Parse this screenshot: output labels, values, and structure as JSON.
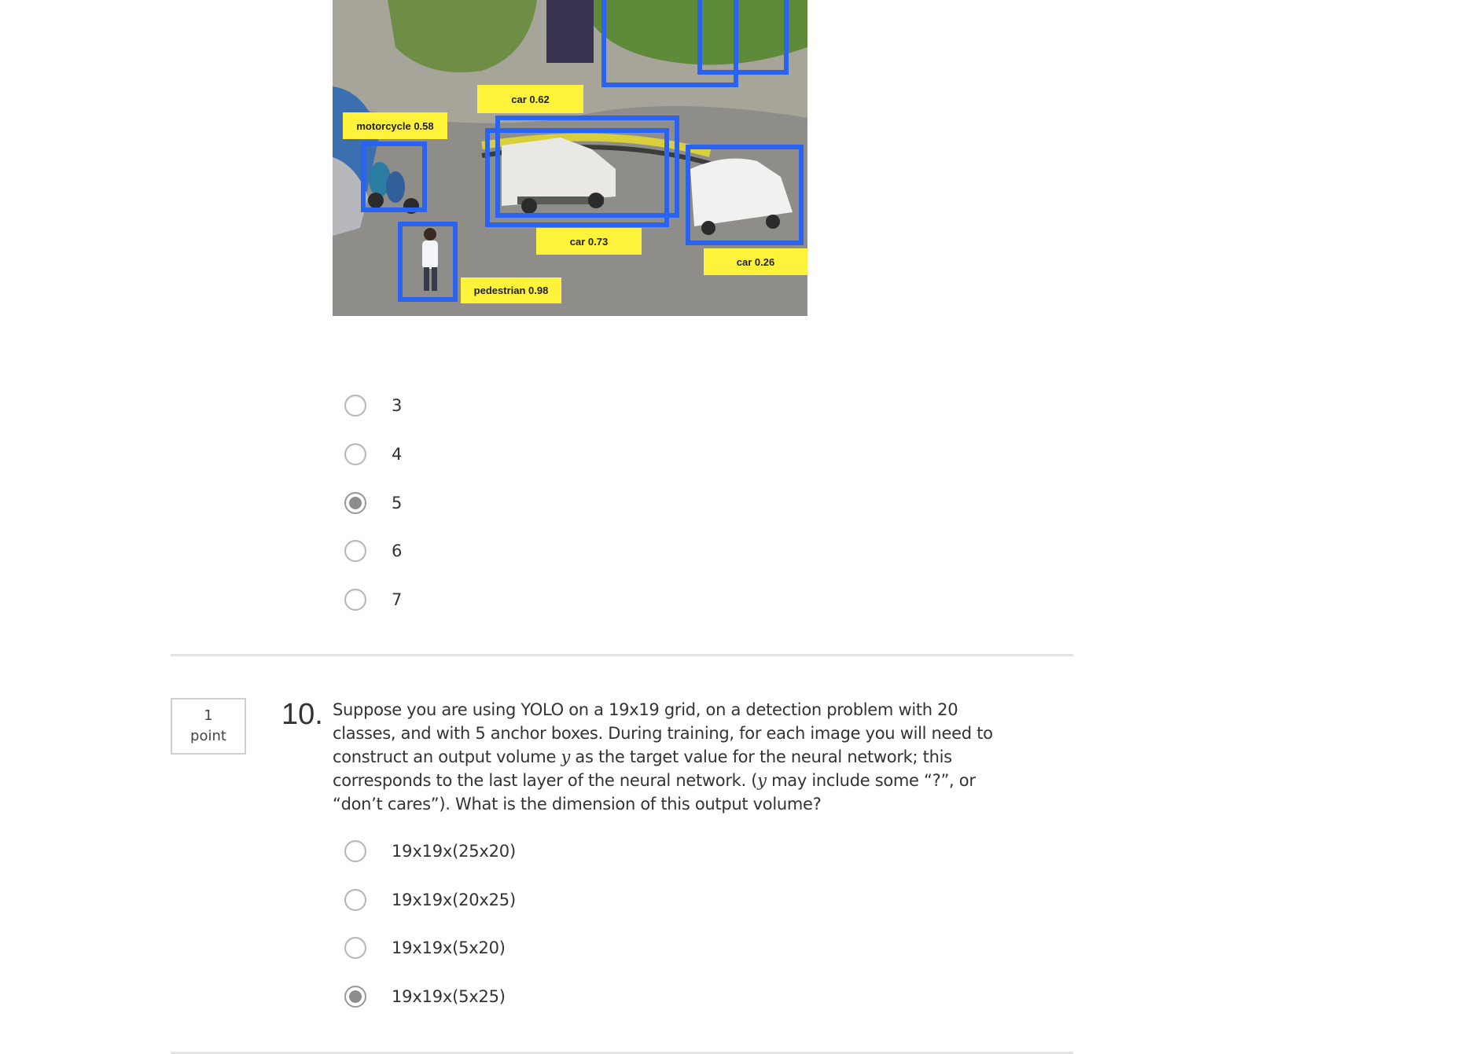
{
  "detection_image": {
    "labels": {
      "car_a": "car  0.62",
      "motorcycle": "motorcycle  0.58",
      "car_b": "car  0.73",
      "car_c": "car 0.26",
      "pedestrian": "pedestrian 0.98"
    }
  },
  "question9": {
    "options": [
      {
        "label": "3",
        "selected": false
      },
      {
        "label": "4",
        "selected": false
      },
      {
        "label": "5",
        "selected": true
      },
      {
        "label": "6",
        "selected": false
      },
      {
        "label": "7",
        "selected": false
      }
    ]
  },
  "question10": {
    "points_value": "1",
    "points_unit": "point",
    "number": "10.",
    "text_part1": "Suppose you are using YOLO on a 19x19 grid, on a detection problem with 20 classes, and with 5 anchor boxes. During training, for each image you will need to construct an output volume ",
    "var1": "y",
    "text_part2": " as the target value for the neural network; this corresponds to the last layer of the neural network. (",
    "var2": "y",
    "text_part3": " may include some “?”, or “don’t cares”). What is the dimension of this output volume?",
    "options": [
      {
        "label": "19x19x(25x20)",
        "selected": false
      },
      {
        "label": "19x19x(20x25)",
        "selected": false
      },
      {
        "label": "19x19x(5x20)",
        "selected": false
      },
      {
        "label": "19x19x(5x25)",
        "selected": true
      }
    ]
  },
  "colors": {
    "box": "#2a63f0",
    "label_bg": "#fff23a",
    "divider": "#e3e3e3",
    "radio_checked": "#8d8d8d"
  }
}
